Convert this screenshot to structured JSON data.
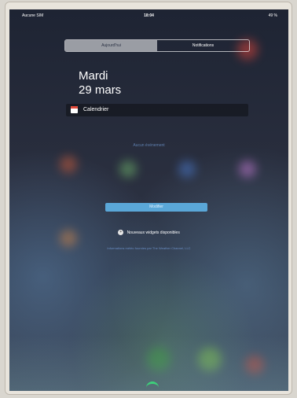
{
  "status_bar": {
    "carrier": "Aucune SIM",
    "time": "18:04",
    "battery": "49 %"
  },
  "tabs": [
    {
      "label": "Aujourd'hui",
      "selected": true
    },
    {
      "label": "Notifications",
      "selected": false
    }
  ],
  "today": {
    "day": "Mardi",
    "date": "29 mars",
    "calendar_label": "Calendrier",
    "no_events": "Aucun événement",
    "edit_button": "Modifier",
    "new_widgets": "Nouveaux widgets disponibles",
    "footer": "Informations météo fournies par The Weather Channel, LLC"
  },
  "colors": {
    "accent": "#5aa7d8",
    "calendar_red": "#e34a3c"
  }
}
